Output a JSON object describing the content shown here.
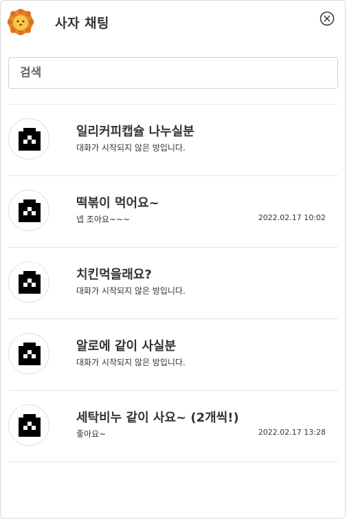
{
  "header": {
    "title": "사자 채팅",
    "logo_icon": "lion-logo-icon",
    "close_icon": "close-circle-icon"
  },
  "search": {
    "placeholder": "검색",
    "value": ""
  },
  "chats": [
    {
      "name": "일리커피캡슐 나누실분",
      "last_message": "대화가 시작되지 않은 방입니다.",
      "time": ""
    },
    {
      "name": "떡볶이 먹어요~",
      "last_message": "넵 조아요~~~",
      "time": "2022.02.17 10:02"
    },
    {
      "name": "치킨먹을래요?",
      "last_message": "대화가 시작되지 않은 방입니다.",
      "time": ""
    },
    {
      "name": "알로에 같이 사실분",
      "last_message": "대화가 시작되지 않은 방입니다.",
      "time": ""
    },
    {
      "name": "세탁비누 같이 사요~ (2개씩!)",
      "last_message": "좋아요~",
      "time": "2022.02.17 13:28"
    }
  ],
  "colors": {
    "accent": "#f2a33a",
    "border": "#e3e3e3",
    "text": "#333333"
  }
}
